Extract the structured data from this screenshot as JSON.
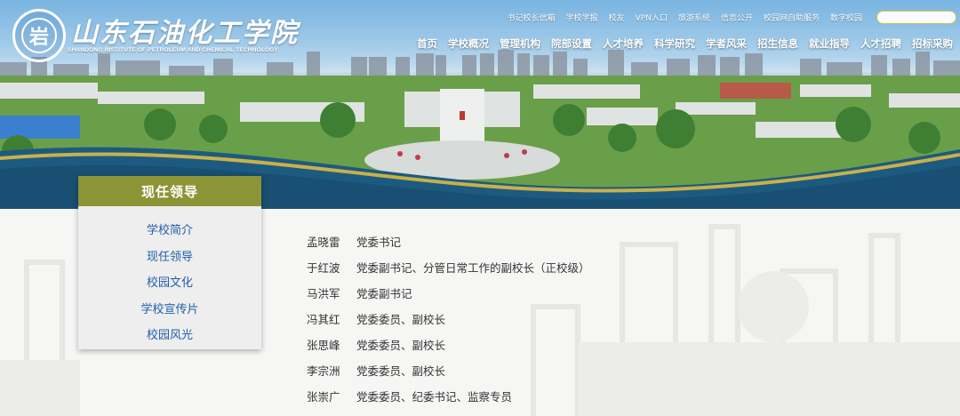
{
  "header": {
    "brand_name": "山东石油化工学院",
    "brand_name_en": "SHANDONG INSTITUTE OF PETROLEUM AND CHEMICAL TECHNOLOGY",
    "logo_glyph": "岩",
    "quick_links": [
      "书记校长信箱",
      "学校学报",
      "校友",
      "VPN入口",
      "旅游系统",
      "信息公开",
      "校园网自助服务",
      "数字校园"
    ],
    "search_placeholder": "",
    "nav": [
      "首页",
      "学校概况",
      "管理机构",
      "院部设置",
      "人才培养",
      "科学研究",
      "学者风采",
      "招生信息",
      "就业指导",
      "人才招聘",
      "招标采购"
    ]
  },
  "sidebar": {
    "title": "现任领导",
    "items": [
      "学校简介",
      "现任领导",
      "校园文化",
      "学校宣传片",
      "校园风光"
    ]
  },
  "leaders": [
    {
      "name": "孟晓雷",
      "title": "党委书记"
    },
    {
      "name": "于红波",
      "title": "党委副书记、分管日常工作的副校长（正校级）"
    },
    {
      "name": "马洪军",
      "title": "党委副书记"
    },
    {
      "name": "冯其红",
      "title": "党委委员、副校长"
    },
    {
      "name": "张思峰",
      "title": "党委委员、副校长"
    },
    {
      "name": "李宗洲",
      "title": "党委委员、副校长"
    },
    {
      "name": "张崇广",
      "title": "党委委员、纪委书记、监察专员"
    }
  ],
  "colors": {
    "sidebar_title_bg": "#8c9436",
    "sidebar_link": "#1f5fa8",
    "band_dark_blue": "#1d5a80",
    "band_gold": "#c8b04a",
    "search_border": "#d4c54a"
  }
}
